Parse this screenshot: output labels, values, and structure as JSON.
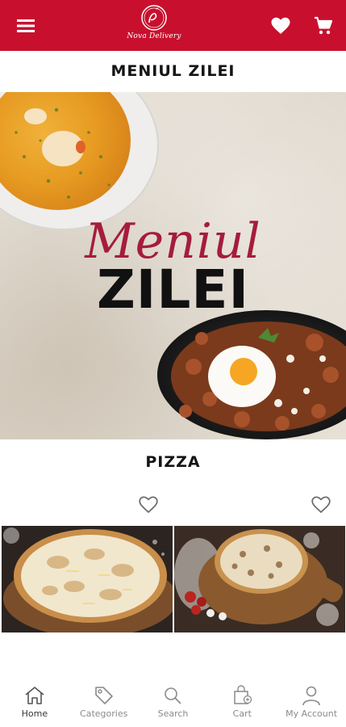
{
  "header": {
    "logo_text": "Nova Delivery",
    "icons": [
      "menu-icon",
      "heart-icon",
      "cart-icon"
    ],
    "brand_color": "#c8102e"
  },
  "sections": {
    "daily_menu_title": "MENIUL ZILEI",
    "pizza_title": "PIZZA"
  },
  "banner": {
    "script_text": "Meniul",
    "bold_text": "ZILEI"
  },
  "bottom_nav": {
    "items": [
      {
        "label": "Home",
        "icon": "home-icon"
      },
      {
        "label": "Categories",
        "icon": "tag-icon"
      },
      {
        "label": "Search",
        "icon": "search-icon"
      },
      {
        "label": "Cart",
        "icon": "cart-icon"
      },
      {
        "label": "My Account",
        "icon": "user-icon"
      }
    ],
    "active": "Home"
  }
}
